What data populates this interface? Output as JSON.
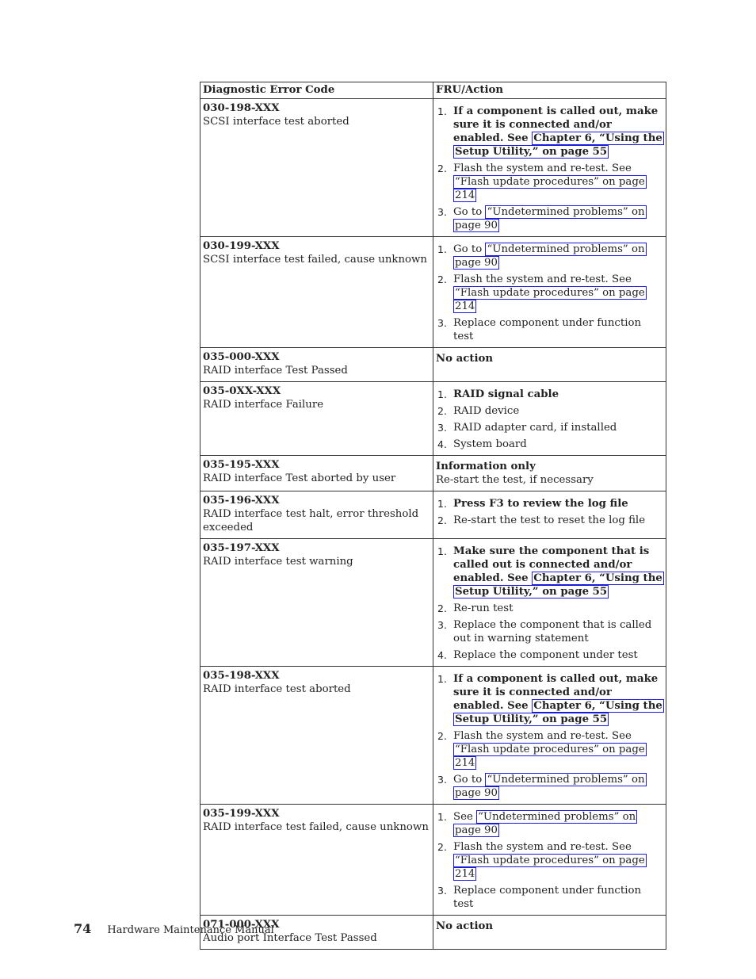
{
  "table": {
    "headers": [
      "Diagnostic Error Code",
      "FRU/Action"
    ],
    "rows": [
      {
        "code": "030-198-XXX",
        "description": "SCSI interface test aborted",
        "actions": [
          {
            "num": "1.",
            "bold": true,
            "text": "If a component is called out, make sure it is connected and/or enabled. See ",
            "link": "Chapter 6, “Using the Setup Utility,” on page 55"
          },
          {
            "num": "2.",
            "bold": false,
            "text": "Flash the system and re-test. See ",
            "link": "“Flash update procedures” on page 214"
          },
          {
            "num": "3.",
            "bold": false,
            "text": "Go to ",
            "link": "“Undetermined problems” on page 90"
          }
        ]
      },
      {
        "code": "030-199-XXX",
        "description": "SCSI interface test failed, cause unknown",
        "actions": [
          {
            "num": "1.",
            "bold": false,
            "text": "Go to ",
            "link": "“Undetermined problems” on page 90"
          },
          {
            "num": "2.",
            "bold": false,
            "text": "Flash the system and re-test. See ",
            "link": "“Flash update procedures” on page 214"
          },
          {
            "num": "3.",
            "bold": false,
            "text": "Replace component under function test",
            "link": ""
          }
        ]
      },
      {
        "code": "035-000-XXX",
        "description": "RAID interface Test Passed",
        "plain_bold": "No action",
        "plain": ""
      },
      {
        "code": "035-0XX-XXX",
        "description": "RAID interface Failure",
        "actions": [
          {
            "num": "1.",
            "bold": true,
            "text": "RAID signal cable",
            "link": ""
          },
          {
            "num": "2.",
            "bold": false,
            "text": "RAID device",
            "link": ""
          },
          {
            "num": "3.",
            "bold": false,
            "text": "RAID adapter card, if installed",
            "link": ""
          },
          {
            "num": "4.",
            "bold": false,
            "text": "System board",
            "link": ""
          }
        ]
      },
      {
        "code": "035-195-XXX",
        "description": "RAID interface Test aborted by user",
        "plain_bold": "Information only",
        "plain": "Re-start the test, if necessary"
      },
      {
        "code": "035-196-XXX",
        "description": "RAID interface test halt, error threshold exceeded",
        "actions": [
          {
            "num": "1.",
            "bold": true,
            "text": "Press F3 to review the log file",
            "link": ""
          },
          {
            "num": "2.",
            "bold": false,
            "text": "Re-start the test to reset the log file",
            "link": ""
          }
        ]
      },
      {
        "code": "035-197-XXX",
        "description": "RAID interface test warning",
        "actions": [
          {
            "num": "1.",
            "bold": true,
            "text": "Make sure the component that is called out is connected and/or enabled. See ",
            "link": "Chapter 6, “Using the Setup Utility,” on page 55"
          },
          {
            "num": "2.",
            "bold": false,
            "text": "Re-run test",
            "link": ""
          },
          {
            "num": "3.",
            "bold": false,
            "text": "Replace the component that is called out in warning statement",
            "link": ""
          },
          {
            "num": "4.",
            "bold": false,
            "text": "Replace the component under test",
            "link": ""
          }
        ]
      },
      {
        "code": "035-198-XXX",
        "description": "RAID interface test aborted",
        "actions": [
          {
            "num": "1.",
            "bold": true,
            "text": "If a component is called out, make sure it is connected and/or enabled. See ",
            "link": "Chapter 6, “Using the Setup Utility,” on page 55"
          },
          {
            "num": "2.",
            "bold": false,
            "text": "Flash the system and re-test. See ",
            "link": "“Flash update procedures” on page 214"
          },
          {
            "num": "3.",
            "bold": false,
            "text": "Go to ",
            "link": "“Undetermined problems” on page 90"
          }
        ]
      },
      {
        "code": "035-199-XXX",
        "description": "RAID interface test failed, cause unknown",
        "actions": [
          {
            "num": "1.",
            "bold": false,
            "text": "See ",
            "link": "“Undetermined problems” on page 90"
          },
          {
            "num": "2.",
            "bold": false,
            "text": "Flash the system and re-test. See ",
            "link": "“Flash update procedures” on page 214"
          },
          {
            "num": "3.",
            "bold": false,
            "text": "Replace component under function test",
            "link": ""
          }
        ]
      },
      {
        "code": "071-000-XXX",
        "description": "Audio port Interface Test Passed",
        "plain_bold": "No action",
        "plain": ""
      }
    ]
  },
  "footer": {
    "page_number": "74",
    "manual_title": "Hardware Maintenance Manual"
  },
  "colors": {
    "link_border": "#1a1adc",
    "table_border": "#333333"
  }
}
